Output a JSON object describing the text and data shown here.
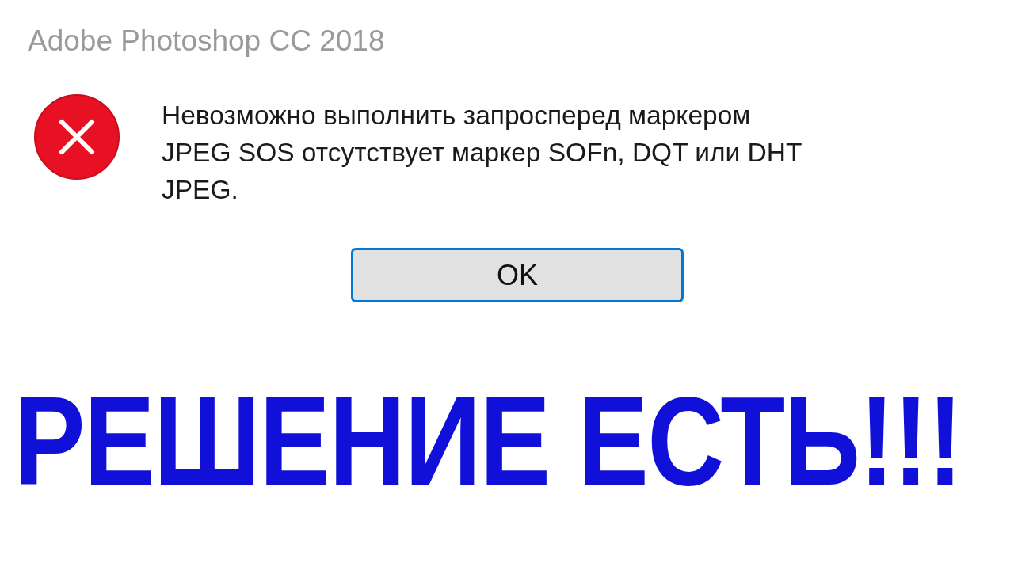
{
  "window": {
    "title": "Adobe Photoshop CC 2018"
  },
  "dialog": {
    "message_lines": [
      "Невозможно выполнить запросперед маркером",
      "JPEG SOS отсутствует маркер SOFn, DQT или DHT",
      "JPEG."
    ],
    "buttons": [
      {
        "label": "OK",
        "selected": true
      }
    ]
  },
  "caption": "РЕШЕНИЕ ЕСТЬ!!!"
}
